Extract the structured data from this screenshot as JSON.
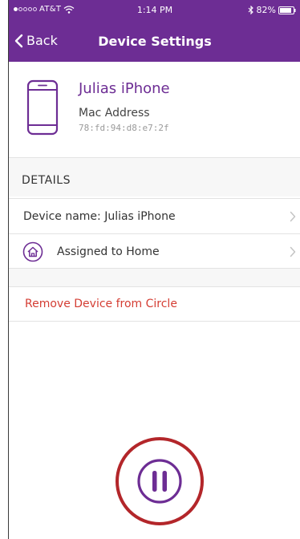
{
  "status_bar": {
    "carrier": "AT&T",
    "time": "1:14 PM",
    "battery": "82%"
  },
  "nav": {
    "back_label": "Back",
    "title": "Device Settings"
  },
  "device": {
    "name": "Julias iPhone",
    "mac_label": "Mac Address",
    "mac_value": "78:fd:94:d8:e7:2f"
  },
  "details": {
    "section_title": "DETAILS",
    "rows": [
      {
        "label": "Device name: Julias iPhone",
        "icon": "chevron-right-icon"
      },
      {
        "label": "Assigned to Home",
        "icon": "home-icon"
      }
    ]
  },
  "actions": {
    "remove_label": "Remove Device from Circle",
    "pause_icon": "pause-icon"
  },
  "colors": {
    "brand": "#6d2d94",
    "danger": "#d43d33",
    "highlight_ring": "#b3262a"
  }
}
